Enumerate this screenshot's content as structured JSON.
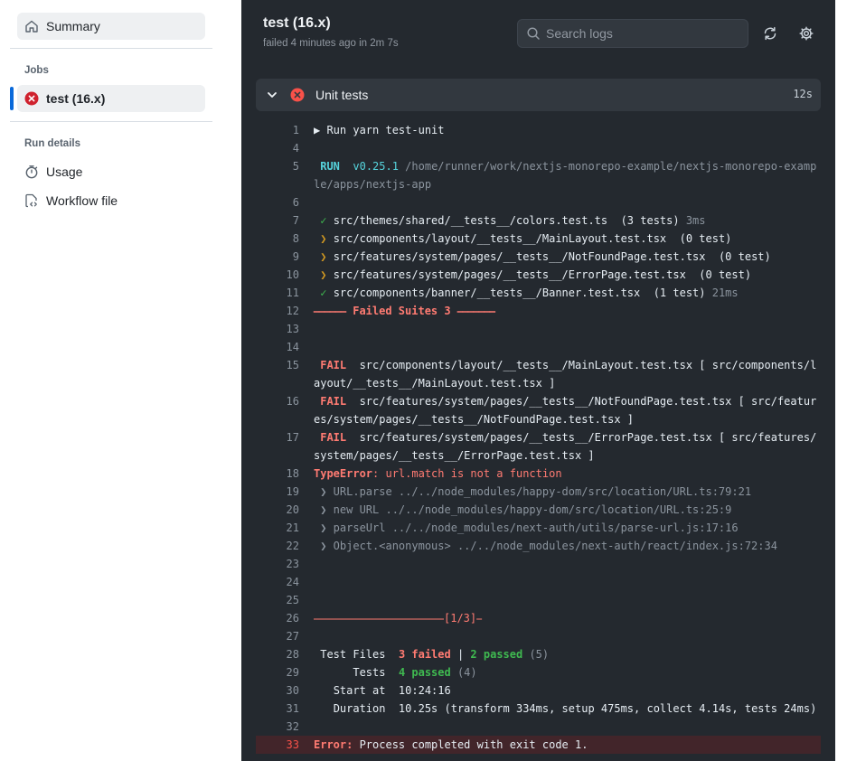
{
  "sidebar": {
    "summary_label": "Summary",
    "jobs_heading": "Jobs",
    "job_label": "test (16.x)",
    "run_details_heading": "Run details",
    "usage_label": "Usage",
    "workflow_label": "Workflow file"
  },
  "header": {
    "title": "test (16.x)",
    "subtitle": "failed 4 minutes ago in 2m 7s",
    "search_placeholder": "Search logs"
  },
  "step": {
    "title": "Unit tests",
    "duration": "12s"
  },
  "colors": {
    "accent": "#0969da",
    "fail": "#cf222e",
    "log_bg": "#24292f"
  },
  "log": {
    "l1_num": "1",
    "l1_a": "▶ Run yarn test-unit",
    "l4_num": "4",
    "l5_num": "5",
    "l5_a": " RUN ",
    "l5_b": " v0.25.1 ",
    "l5_c": "/home/runner/work/nextjs-monorepo-example/nextjs-monorepo-example/apps/nextjs-app",
    "l6_num": "6",
    "l7_num": "7",
    "l7_a": " ✓ ",
    "l7_b": "src/themes/shared/__tests__/colors.test.ts  (3 tests) ",
    "l7_c": "3ms",
    "l8_num": "8",
    "l8_a": " ❯ ",
    "l8_b": "src/components/layout/__tests__/MainLayout.test.tsx  (0 test)",
    "l9_num": "9",
    "l9_a": " ❯ ",
    "l9_b": "src/features/system/pages/__tests__/NotFoundPage.test.tsx  (0 test)",
    "l10_num": "10",
    "l10_a": " ❯ ",
    "l10_b": "src/features/system/pages/__tests__/ErrorPage.test.tsx  (0 test)",
    "l11_num": "11",
    "l11_a": " ✓ ",
    "l11_b": "src/components/banner/__tests__/Banner.test.tsx  (1 test) ",
    "l11_c": "21ms",
    "l12_num": "12",
    "l12_a": "⎯⎯⎯⎯⎯⎯ Failed Suites 3 ⎯⎯⎯⎯⎯⎯⎯",
    "l13_num": "13",
    "l14_num": "14",
    "l15_num": "15",
    "l15_a": " FAIL ",
    "l15_b": " src/components/layout/__tests__/MainLayout.test.tsx [ src/components/layout/__tests__/MainLayout.test.tsx ]",
    "l16_num": "16",
    "l16_a": " FAIL ",
    "l16_b": " src/features/system/pages/__tests__/NotFoundPage.test.tsx [ src/features/system/pages/__tests__/NotFoundPage.test.tsx ]",
    "l17_num": "17",
    "l17_a": " FAIL ",
    "l17_b": " src/features/system/pages/__tests__/ErrorPage.test.tsx [ src/features/system/pages/__tests__/ErrorPage.test.tsx ]",
    "l18_num": "18",
    "l18_a": "TypeError",
    "l18_b": ": url.match is not a function",
    "l19_num": "19",
    "l19_a": " ❯ URL.parse ../../node_modules/happy-dom/src/location/URL.ts:79:21",
    "l20_num": "20",
    "l20_a": " ❯ new URL ../../node_modules/happy-dom/src/location/URL.ts:25:9",
    "l21_num": "21",
    "l21_a": " ❯ parseUrl ../../node_modules/next-auth/utils/parse-url.js:17:16",
    "l22_num": "22",
    "l22_a": " ❯ Object.<anonymous> ../../node_modules/next-auth/react/index.js:72:34",
    "l23_num": "23",
    "l24_num": "24",
    "l25_num": "25",
    "l26_num": "26",
    "l26_a": "⎯⎯⎯⎯⎯⎯⎯⎯⎯⎯⎯⎯⎯⎯⎯⎯⎯⎯⎯⎯⎯⎯⎯⎯[1/3]⎯",
    "l27_num": "27",
    "l28_num": "28",
    "l28_a": " Test Files  ",
    "l28_b": "3 failed",
    "l28_c": " | ",
    "l28_d": "2 passed",
    "l28_e": " (5)",
    "l29_num": "29",
    "l29_a": "      Tests  ",
    "l29_b": "4 passed",
    "l29_c": " (4)",
    "l30_num": "30",
    "l30_a": "   Start at  10:24:16",
    "l31_num": "31",
    "l31_a": "   Duration  10.25s (transform 334ms, setup 475ms, collect 4.14s, tests 24ms)",
    "l32_num": "32",
    "l33_num": "33",
    "l33_a": "Error:",
    "l33_b": " Process completed with exit code 1."
  }
}
